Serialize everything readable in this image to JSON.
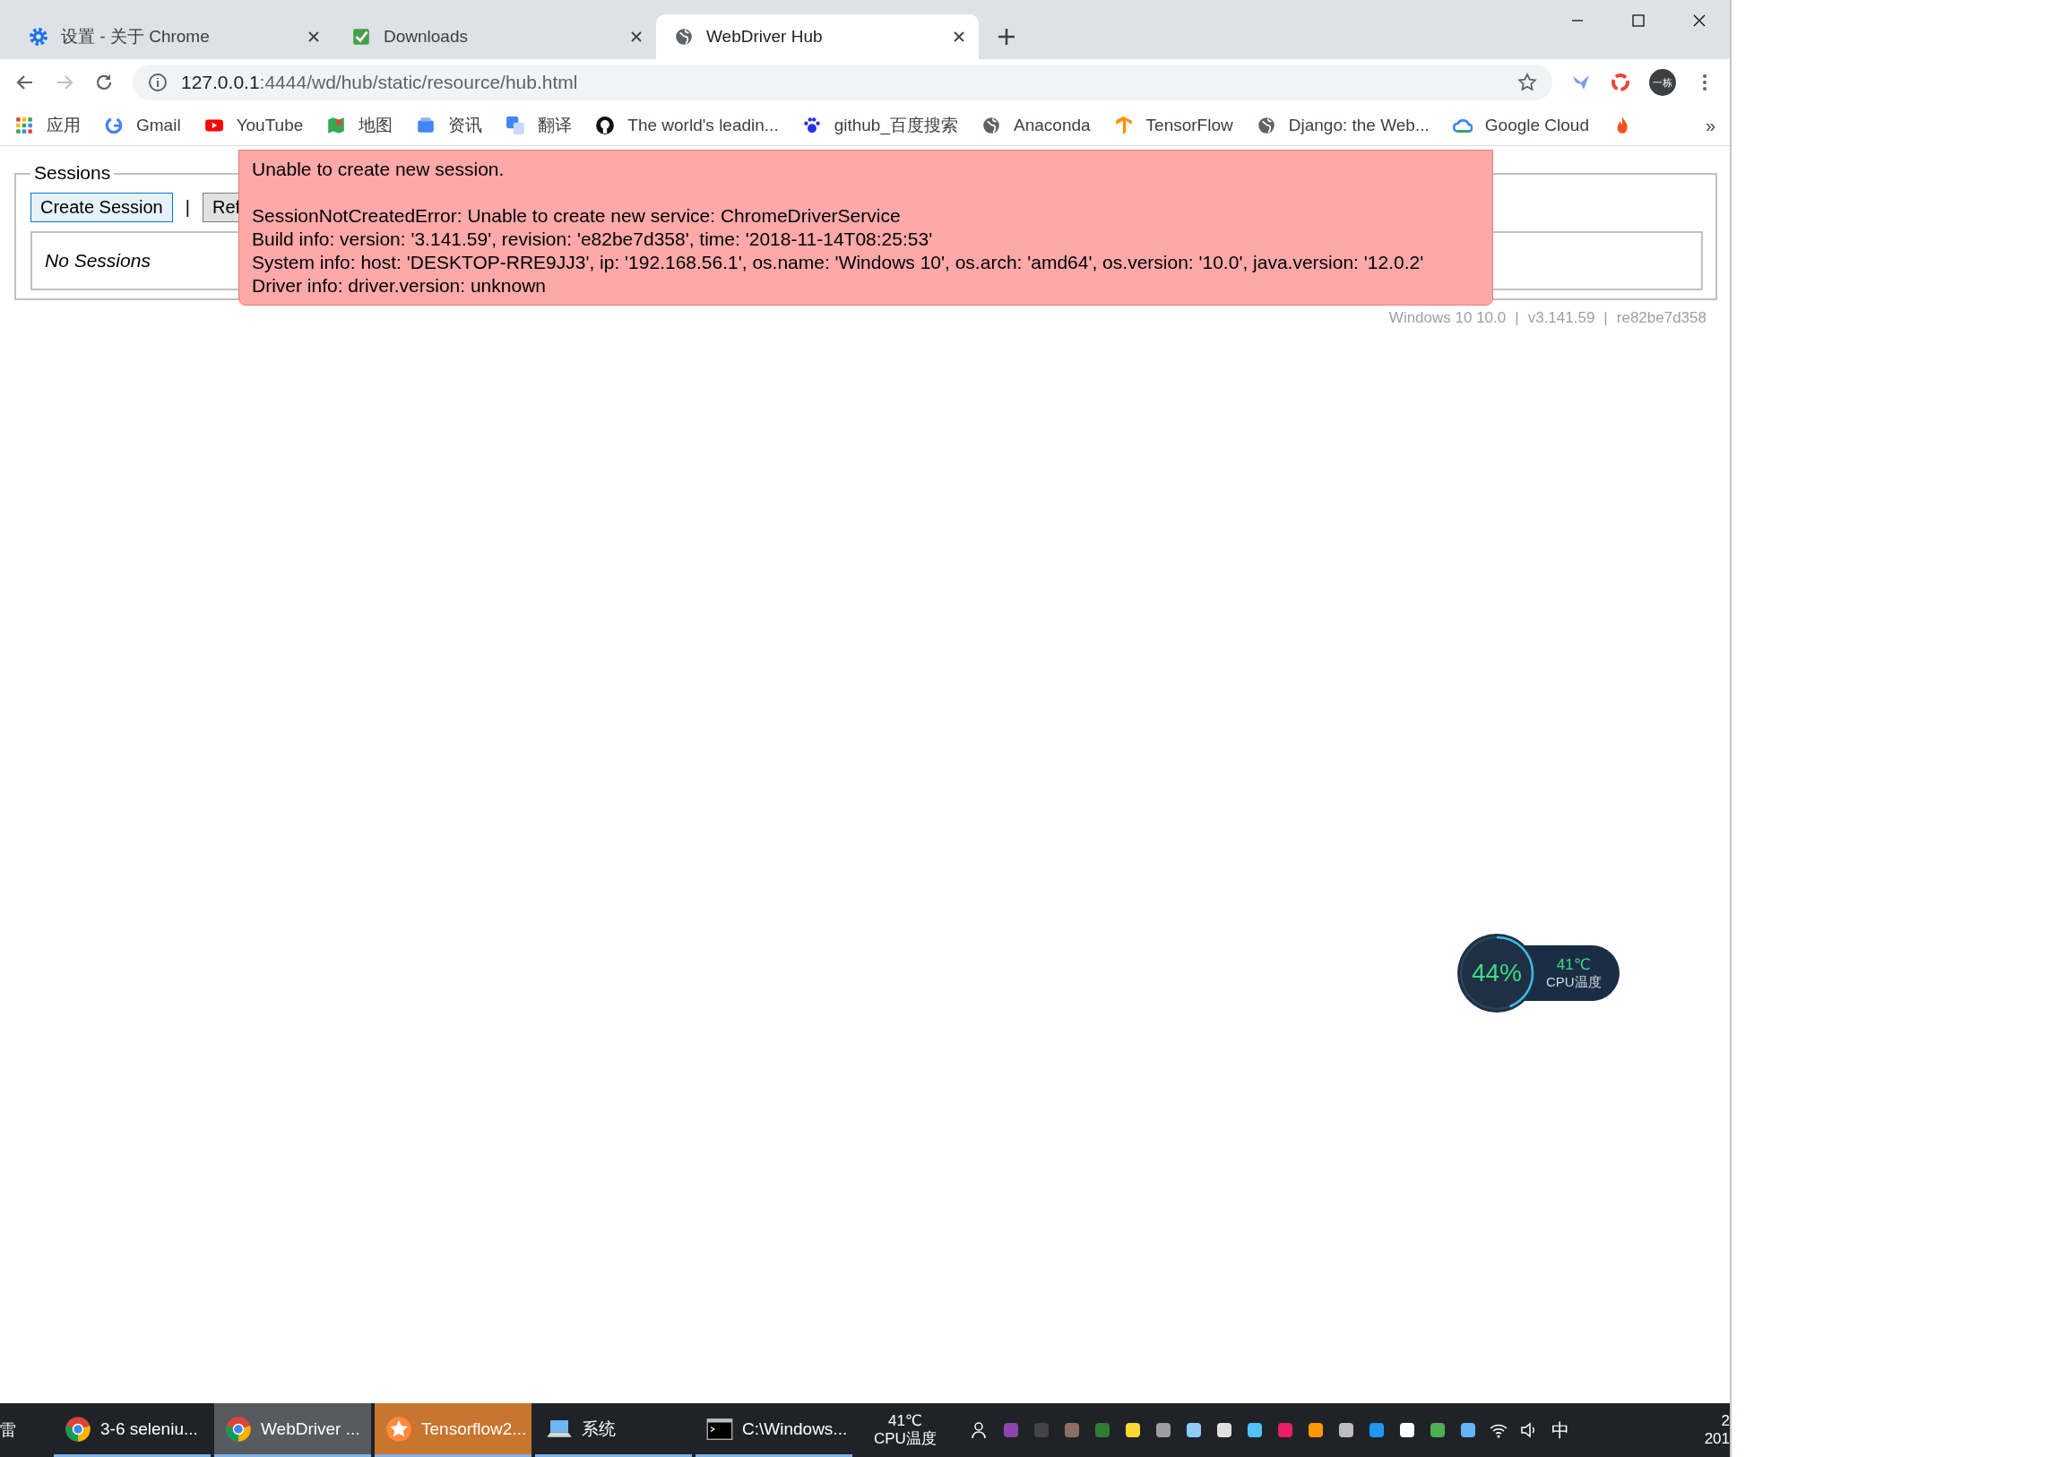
{
  "tabs": [
    {
      "title": "设置 - 关于 Chrome",
      "kind": "gear",
      "selected": false
    },
    {
      "title": "Downloads",
      "kind": "check",
      "selected": false
    },
    {
      "title": "WebDriver Hub",
      "kind": "globe",
      "selected": true
    }
  ],
  "address": {
    "host": "127.0.0.1",
    "path": ":4444/wd/hub/static/resource/hub.html",
    "avatar": "一栋"
  },
  "bookmarks": [
    {
      "label": "应用",
      "kind": "apps"
    },
    {
      "label": "Gmail",
      "kind": "g"
    },
    {
      "label": "YouTube",
      "kind": "play"
    },
    {
      "label": "地图",
      "kind": "map"
    },
    {
      "label": "资讯",
      "kind": "news"
    },
    {
      "label": "翻译",
      "kind": "translate"
    },
    {
      "label": "The world's leadin...",
      "kind": "octocat"
    },
    {
      "label": "github_百度搜索",
      "kind": "paw"
    },
    {
      "label": "Anaconda",
      "kind": "globe"
    },
    {
      "label": "TensorFlow",
      "kind": "tf"
    },
    {
      "label": "Django: the Web...",
      "kind": "globe"
    },
    {
      "label": "Google Cloud",
      "kind": "cloud"
    }
  ],
  "more": "»",
  "sessions": {
    "legend": "Sessions",
    "create_button": "Create Session",
    "separator": "|",
    "refresh_button": "Ref",
    "empty": "No Sessions",
    "footer": [
      "Windows 10 10.0",
      "|",
      "v3.141.59",
      "|",
      "re82be7d358"
    ]
  },
  "error": {
    "title": "Unable to create new session.",
    "lines": [
      "SessionNotCreatedError: Unable to create new service: ChromeDriverService",
      "Build info: version: '3.141.59', revision: 'e82be7d358', time: '2018-11-14T08:25:53'",
      "System info: host: 'DESKTOP-RRE9JJ3', ip: '192.168.56.1', os.name: 'Windows 10', os.arch: 'amd64', os.version: '10.0', java.version: '12.0.2'",
      "Driver info: driver.version: unknown"
    ]
  },
  "cpu_widget": {
    "percent": "44%",
    "level": 0.44,
    "temperature": "41℃",
    "label": "CPU温度"
  },
  "taskbar": {
    "start": "雷",
    "apps": [
      {
        "label": "3-6 seleniu...",
        "kind": "chrome",
        "selected": false,
        "flashing": false
      },
      {
        "label": "WebDriver ...",
        "kind": "chrome",
        "selected": true,
        "flashing": false
      },
      {
        "label": "Tensorflow2...",
        "kind": "star",
        "selected": false,
        "flashing": true
      },
      {
        "label": "系统",
        "kind": "laptop",
        "selected": false,
        "flashing": false
      },
      {
        "label": "C:\\Windows...",
        "kind": "console",
        "selected": false,
        "flashing": false
      }
    ],
    "temperature": "41℃",
    "temperature_label": "CPU温度",
    "ime": "中",
    "clock_line1": "2",
    "clock_line2": "201"
  }
}
